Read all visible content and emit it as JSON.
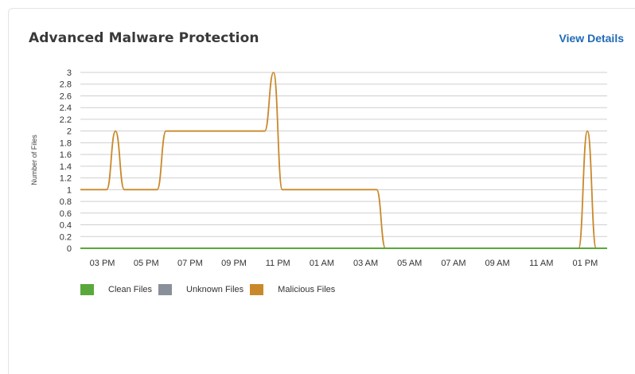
{
  "widget": {
    "title": "Advanced Malware Protection",
    "view_details_label": "View Details"
  },
  "chart_data": {
    "type": "line",
    "ylabel": "Number of Files",
    "xlabel": "",
    "ylim": [
      0,
      3
    ],
    "y_ticks": [
      "0",
      "0.2",
      "0.4",
      "0.6",
      "0.8",
      "1",
      "1.2",
      "1.4",
      "1.6",
      "1.8",
      "2",
      "2.2",
      "2.4",
      "2.6",
      "2.8",
      "3"
    ],
    "x_range_hours": [
      0,
      24
    ],
    "x_ticks": [
      {
        "label": "03 PM",
        "h": 1
      },
      {
        "label": "05 PM",
        "h": 3
      },
      {
        "label": "07 PM",
        "h": 5
      },
      {
        "label": "09 PM",
        "h": 7
      },
      {
        "label": "11 PM",
        "h": 9
      },
      {
        "label": "01 AM",
        "h": 11
      },
      {
        "label": "03 AM",
        "h": 13
      },
      {
        "label": "05 AM",
        "h": 15
      },
      {
        "label": "07 AM",
        "h": 17
      },
      {
        "label": "09 AM",
        "h": 19
      },
      {
        "label": "11 AM",
        "h": 21
      },
      {
        "label": "01 PM",
        "h": 23
      }
    ],
    "grid": true,
    "legend_position": "bottom-left",
    "series": [
      {
        "name": "Clean Files",
        "color": "#5aa83c",
        "points": [
          [
            0,
            0
          ],
          [
            24,
            0
          ]
        ]
      },
      {
        "name": "Unknown Files",
        "color": "#8a9099",
        "points": [
          [
            0,
            0
          ],
          [
            24,
            0
          ]
        ]
      },
      {
        "name": "Malicious Files",
        "color": "#c9892b",
        "points": [
          [
            0,
            1
          ],
          [
            1.2,
            1
          ],
          [
            1.6,
            2
          ],
          [
            2,
            1
          ],
          [
            3.5,
            1
          ],
          [
            3.9,
            2
          ],
          [
            5.5,
            2
          ],
          [
            8.4,
            2
          ],
          [
            8.8,
            3
          ],
          [
            9.2,
            1
          ],
          [
            13.5,
            1
          ],
          [
            13.9,
            0
          ],
          [
            22.7,
            0
          ],
          [
            23.1,
            2
          ],
          [
            23.5,
            0
          ],
          [
            24,
            0
          ]
        ]
      }
    ]
  }
}
